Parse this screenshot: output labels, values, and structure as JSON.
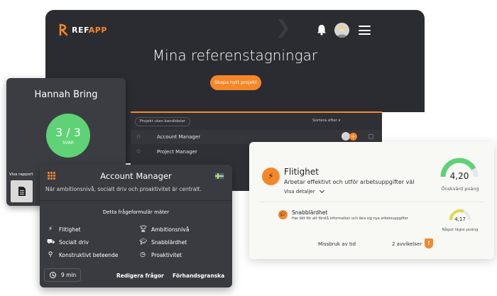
{
  "header": {
    "logo_main": "REF",
    "logo_accent": "APP",
    "title": "Mina referenstagningar",
    "create_button": "Skapa nytt projekt"
  },
  "projects": {
    "filter": "Projekt utan kandidater",
    "sort": "Sortera efter",
    "rows": [
      {
        "name": "Account Manager"
      },
      {
        "name": "Project Manager"
      }
    ]
  },
  "person": {
    "name": "Hannah Bring",
    "score": "3 / 3",
    "score_label": "SVAR",
    "report_label": "Visa rapport"
  },
  "form": {
    "title": "Account Manager",
    "description": "När ambitionsnivå, socialt driv och proaktivitet är centralt.",
    "measures_title": "Detta frågeformulär mäter",
    "traits": [
      {
        "label": "Flitighet",
        "icon": "bolt-icon"
      },
      {
        "label": "Ambitionsnivå",
        "icon": "trophy-icon"
      },
      {
        "label": "Socialt driv",
        "icon": "truck-icon"
      },
      {
        "label": "Snabblärdhet",
        "icon": "graduation-cap-icon"
      },
      {
        "label": "Konstruktivt beteende",
        "icon": "location-pin-icon"
      },
      {
        "label": "Proaktivitet",
        "icon": "clock-forward-icon"
      }
    ],
    "duration": "9 min",
    "edit_label": "Redigera frågor",
    "preview_label": "Förhandsgranska"
  },
  "result": {
    "title": "Flitighet",
    "subtitle": "Arbetar effektivt och utför arbetsuppgifter väl",
    "details_label": "Visa detaljer",
    "score": "4,20",
    "score_fraction": 0.84,
    "score_label": "Önskvärd poäng",
    "score_color": "#5ed275",
    "sub_title": "Snabblärdhet",
    "sub_desc": "Har lätt för att förstå information och lära sig nya arbetsuppgifter",
    "sub_score": "4,17",
    "sub_score_fraction": 0.62,
    "sub_score_label": "Något lägre poäng",
    "sub_score_color": "#e2d84c",
    "misuse_label": "Missbruk av tid",
    "deviation_label": "2 avvikelser"
  },
  "colors": {
    "accent": "#f5872a",
    "dark": "#2b2c31",
    "success": "#5ed275"
  }
}
